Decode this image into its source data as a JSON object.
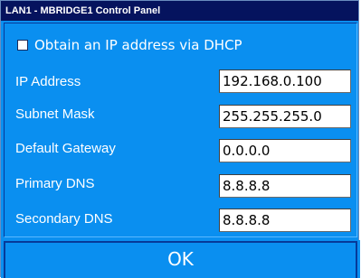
{
  "window": {
    "title": "LAN1 - MBRIDGE1  Control Panel"
  },
  "dhcp": {
    "label": "Obtain an IP address via DHCP",
    "checked": false
  },
  "fields": {
    "ip_address": {
      "label": "IP Address",
      "value": "192.168.0.100"
    },
    "subnet_mask": {
      "label": "Subnet Mask",
      "value": "255.255.255.0"
    },
    "default_gateway": {
      "label": "Default Gateway",
      "value": "0.0.0.0"
    },
    "primary_dns": {
      "label": "Primary DNS",
      "value": "8.8.8.8"
    },
    "secondary_dns": {
      "label": "Secondary DNS",
      "value": "8.8.8.8"
    }
  },
  "buttons": {
    "ok_label": "OK"
  },
  "colors": {
    "titlebar": "#05135e",
    "panel_background": "#0a8ff0",
    "input_background": "#ffffff",
    "text": "#ffffff"
  }
}
